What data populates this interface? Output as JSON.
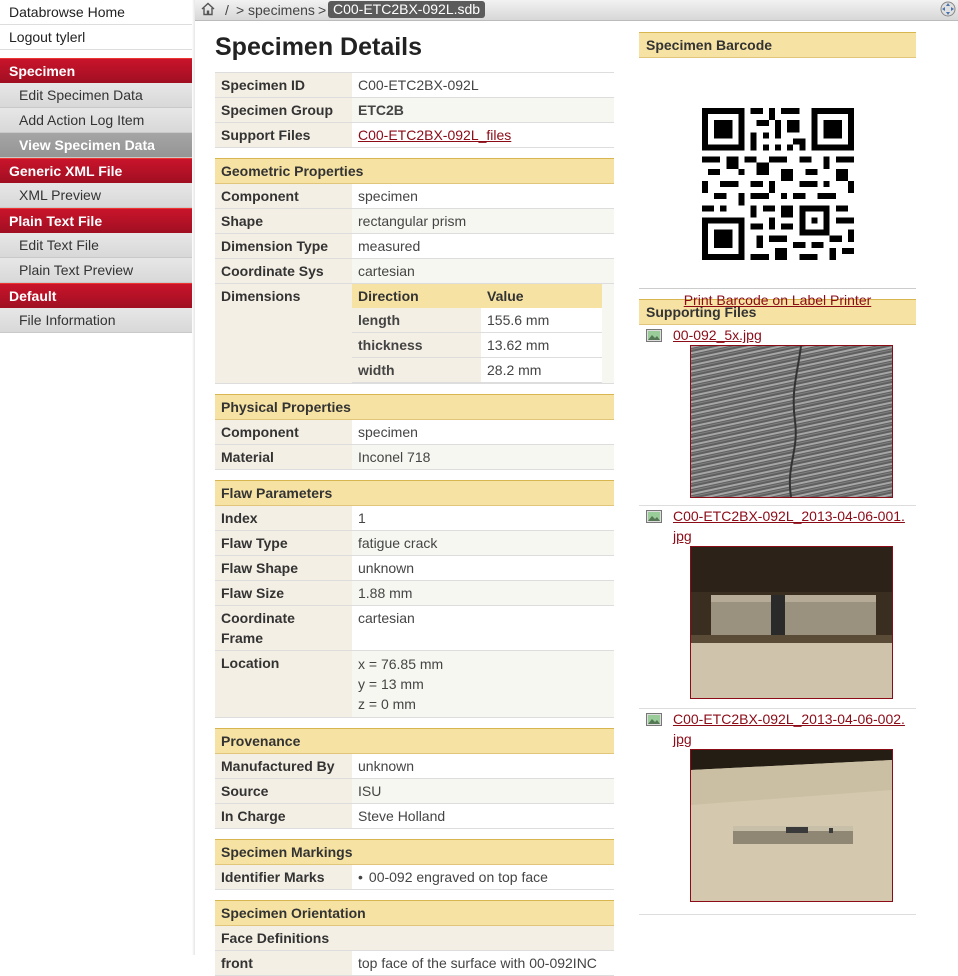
{
  "sidebar": {
    "links": [
      "Databrowse Home",
      "Logout tylerl"
    ],
    "sections": [
      {
        "title": "Specimen",
        "items": [
          {
            "label": "Edit Specimen Data",
            "active": false
          },
          {
            "label": "Add Action Log Item",
            "active": false
          },
          {
            "label": "View Specimen Data",
            "active": true
          }
        ]
      },
      {
        "title": "Generic XML File",
        "items": [
          {
            "label": "XML Preview",
            "active": false
          }
        ]
      },
      {
        "title": "Plain Text File",
        "items": [
          {
            "label": "Edit Text File",
            "active": false
          },
          {
            "label": "Plain Text Preview",
            "active": false
          }
        ]
      },
      {
        "title": "Default",
        "items": [
          {
            "label": "File Information",
            "active": false
          }
        ]
      }
    ]
  },
  "breadcrumb": {
    "home_icon": "home-icon",
    "sep1": "/",
    "sep2": ">",
    "folder": "specimens",
    "sep3": ">",
    "current": "C00-ETC2BX-092L.sdb",
    "fit_icon": "fit-window-icon"
  },
  "main": {
    "title": "Specimen Details",
    "summary": [
      {
        "key": "Specimen ID",
        "value": "C00-ETC2BX-092L"
      },
      {
        "key": "Specimen Group",
        "value": "ETC2B"
      },
      {
        "key": "Support Files",
        "value": "C00-ETC2BX-092L_files",
        "link": true
      }
    ],
    "geometric": {
      "title": "Geometric Properties",
      "rows": [
        {
          "key": "Component",
          "value": "specimen"
        },
        {
          "key": "Shape",
          "value": "rectangular prism"
        },
        {
          "key": "Dimension Type",
          "value": "measured"
        },
        {
          "key": "Coordinate Sys",
          "value": "cartesian"
        }
      ],
      "dimensions_label": "Dimensions",
      "dim_headers": [
        "Direction",
        "Value"
      ],
      "dims": [
        {
          "direction": "length",
          "value": "155.6 mm"
        },
        {
          "direction": "thickness",
          "value": "13.62 mm"
        },
        {
          "direction": "width",
          "value": "28.2 mm"
        }
      ]
    },
    "physical": {
      "title": "Physical Properties",
      "rows": [
        {
          "key": "Component",
          "value": "specimen"
        },
        {
          "key": "Material",
          "value": "Inconel 718"
        }
      ]
    },
    "flaw": {
      "title": "Flaw Parameters",
      "rows": [
        {
          "key": "Index",
          "value": "1"
        },
        {
          "key": "Flaw Type",
          "value": "fatigue crack"
        },
        {
          "key": "Flaw Shape",
          "value": "unknown"
        },
        {
          "key": "Flaw Size",
          "value": "1.88 mm"
        }
      ],
      "coord_key_1": "Coordinate",
      "coord_key_2": "Frame",
      "coord_value": "cartesian",
      "location_key": "Location",
      "location": [
        "x  =  76.85 mm",
        "y  =  13 mm",
        "z  =  0  mm"
      ]
    },
    "provenance": {
      "title": "Provenance",
      "rows": [
        {
          "key": "Manufactured By",
          "value": "unknown"
        },
        {
          "key": "Source",
          "value": "ISU"
        },
        {
          "key": "In Charge",
          "value": "Steve Holland"
        }
      ]
    },
    "markings": {
      "title": "Specimen Markings",
      "key": "Identifier Marks",
      "value": "00-092 engraved on top face"
    },
    "orientation": {
      "title": "Specimen Orientation",
      "sub": "Face Definitions",
      "partial_key": "front",
      "partial_value": "top face of the surface with 00-092INC"
    }
  },
  "right": {
    "barcode_title": "Specimen Barcode",
    "print_link": "Print Barcode on Label Printer",
    "files_title": "Supporting Files",
    "files": [
      {
        "name_1": "00-092_5x.jpg",
        "name_2": "",
        "icon": "image-file-icon"
      },
      {
        "name_1": "C00-ETC2BX-092L_2013-04-06-001.",
        "name_2": "jpg",
        "icon": "image-file-icon"
      },
      {
        "name_1": "C00-ETC2BX-092L_2013-04-06-002.",
        "name_2": "jpg",
        "icon": "image-file-icon"
      }
    ]
  },
  "colors": {
    "accent_red": "#b3122a",
    "section_yellow": "#f6e3a4",
    "link": "#8b0b17"
  }
}
